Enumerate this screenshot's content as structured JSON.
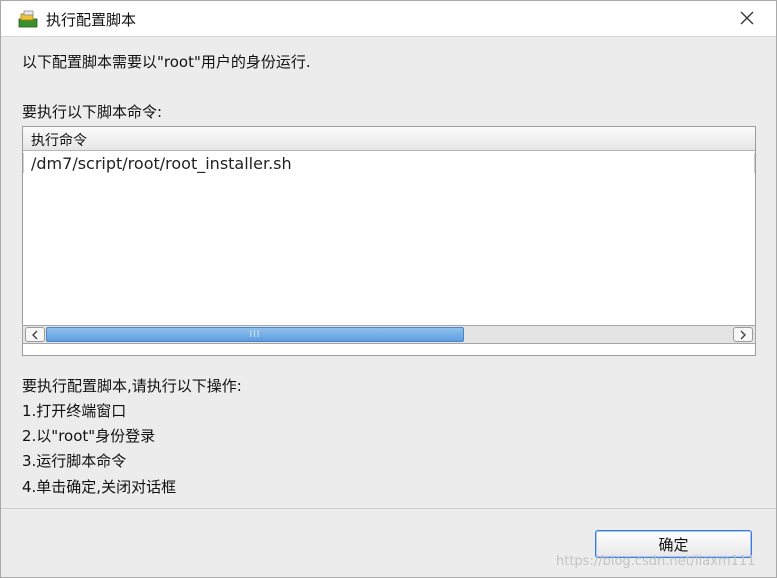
{
  "window": {
    "title": "执行配置脚本",
    "icons": {
      "app": "installer-icon",
      "close": "close-icon"
    }
  },
  "content": {
    "description": "以下配置脚本需要以\"root\"用户的身份运行.",
    "commands_heading": "要执行以下脚本命令:",
    "table": {
      "column_header": "执行命令",
      "rows": [
        "/dm7/script/root/root_installer.sh"
      ]
    },
    "scrollbar": {
      "grip": "III",
      "position_fraction": 0.0,
      "visible_fraction": 0.6
    },
    "instructions_title": "要执行配置脚本,请执行以下操作:",
    "steps": [
      "1.打开终端窗口",
      "2.以\"root\"身份登录",
      "3.运行脚本命令",
      "4.单击确定,关闭对话框"
    ]
  },
  "footer": {
    "ok_label": "确定",
    "watermark": "https://blog.csdn.net/liaxm111"
  },
  "colors": {
    "accent": "#3d7ad8",
    "scroll_thumb": "#6aa5e3",
    "background": "#ececec"
  }
}
